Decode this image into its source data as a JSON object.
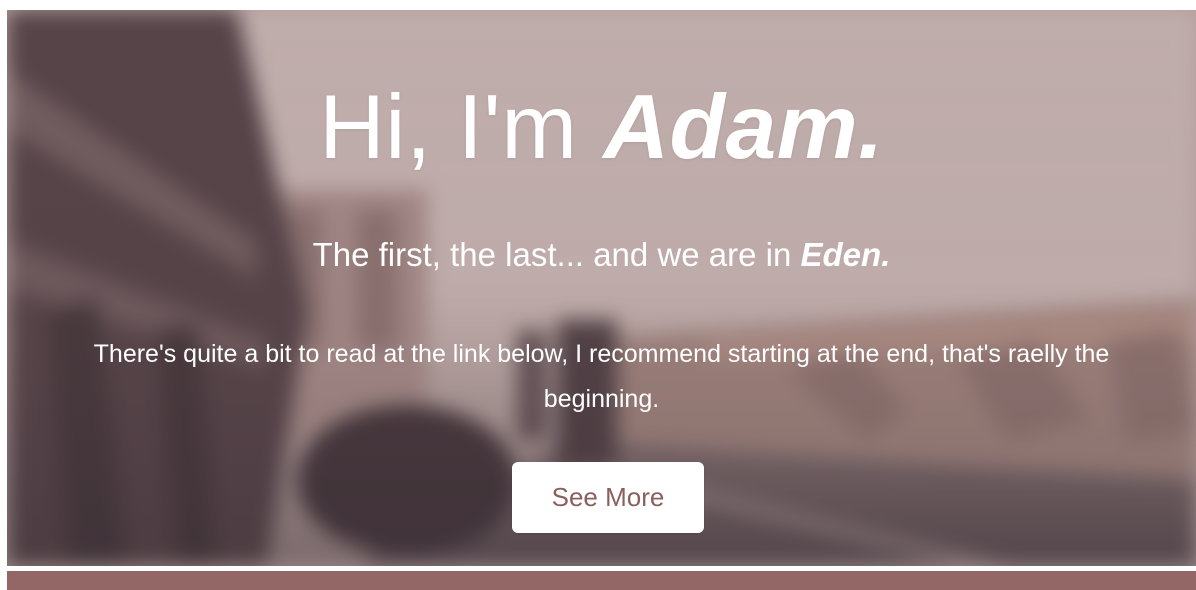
{
  "hero": {
    "headline_prefix": "Hi, I'm ",
    "headline_name": "Adam.",
    "subheading_prefix": "The first, the last... and we are in ",
    "subheading_emphasis": "Eden.",
    "intro_text": "There's quite a bit to read at the link below, I recommend starting at the end, that's raelly the beginning.",
    "cta_label": "See More"
  },
  "colors": {
    "accent": "#926766",
    "button_text": "#8c5f5f",
    "text": "#ffffff"
  }
}
